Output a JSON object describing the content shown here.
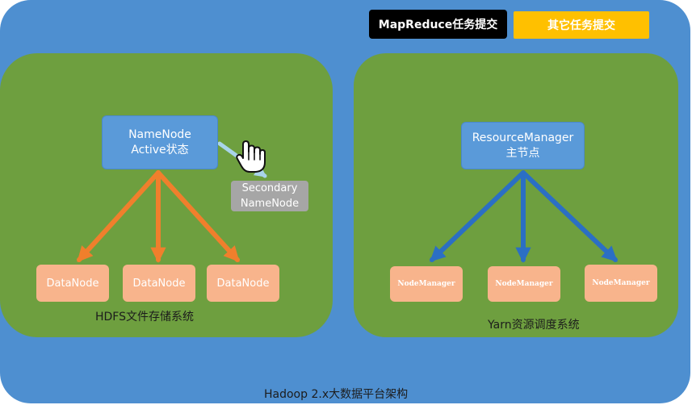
{
  "title": "Hadoop 2.x大数据平台架构",
  "buttons": {
    "mapreduce": "MapReduce任务提交",
    "other": "其它任务提交"
  },
  "hdfs": {
    "caption": "HDFS文件存储系统",
    "namenode_line1": "NameNode",
    "namenode_line2": "Active状态",
    "secondary_line1": "Secondary",
    "secondary_line2": "NameNode",
    "datanodes": [
      "DataNode",
      "DataNode",
      "DataNode"
    ]
  },
  "yarn": {
    "caption": "Yarn资源调度系统",
    "rm_line1": "ResourceManager",
    "rm_line2": "主节点",
    "nodemanagers": [
      "NodeManager",
      "NodeManager",
      "NodeManager"
    ]
  },
  "colors": {
    "platform": "#4e8fd0",
    "cluster": "#6e9f3f",
    "node_blue": "#5a9ad9",
    "datanode": "#f8b48c",
    "arrow_orange": "#f07f2c",
    "arrow_blue": "#2b6fc4",
    "secondary": "#a6a6a6",
    "other_button": "#ffc000"
  },
  "icons": {
    "cursor": "hand-pointer-icon"
  }
}
